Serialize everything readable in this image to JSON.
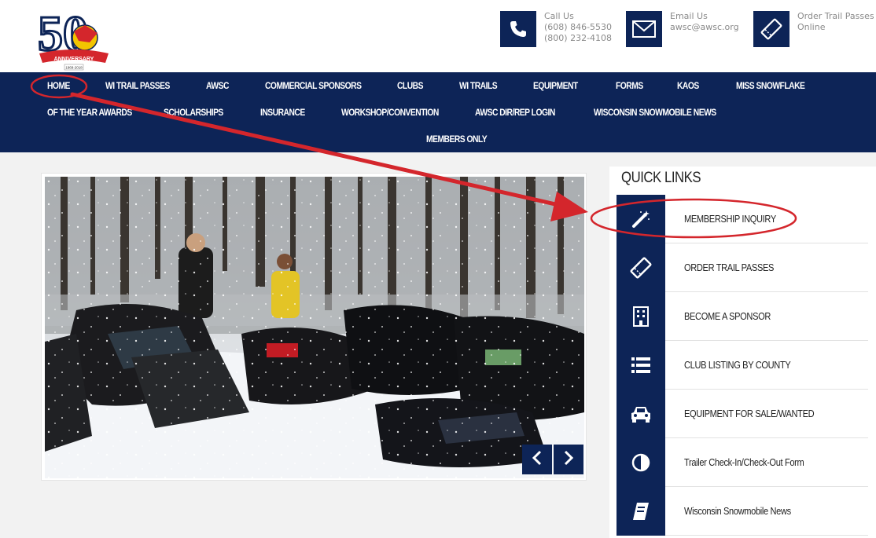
{
  "header": {
    "logo": {
      "number": "50",
      "banner": "ANNIVERSARY",
      "badge": "AWSC",
      "years": "1968-2018"
    },
    "call": {
      "icon": "phone-icon",
      "label": "Call Us",
      "phone1": "(608) 846-5530",
      "phone2": "(800) 232-4108"
    },
    "email": {
      "icon": "envelope-icon",
      "label": "Email Us",
      "address": "awsc@awsc.org"
    },
    "order": {
      "icon": "ticket-icon",
      "label": "Order Trail Passes",
      "label2": "Online"
    }
  },
  "nav": {
    "row1": [
      "HOME",
      "WI TRAIL PASSES",
      "AWSC",
      "COMMERCIAL SPONSORS",
      "CLUBS",
      "WI TRAILS",
      "EQUIPMENT",
      "FORMS",
      "KAOS",
      "MISS SNOWFLAKE"
    ],
    "row2": [
      "OF THE YEAR AWARDS",
      "SCHOLARSHIPS",
      "INSURANCE",
      "WORKSHOP/CONVENTION",
      "AWSC DIR/REP LOGIN",
      "WISCONSIN SNOWMOBILE NEWS"
    ],
    "row3": [
      "MEMBERS ONLY"
    ]
  },
  "slider": {
    "prev_icon": "chevron-left-icon",
    "next_icon": "chevron-right-icon"
  },
  "quick_links": {
    "title": "QUICK LINKS",
    "items": [
      {
        "label": "MEMBERSHIP INQUIRY",
        "icon": "magic-wand-icon"
      },
      {
        "label": "ORDER TRAIL PASSES",
        "icon": "ticket-icon"
      },
      {
        "label": "BECOME A SPONSOR",
        "icon": "building-icon"
      },
      {
        "label": "CLUB LISTING BY COUNTY",
        "icon": "list-icon"
      },
      {
        "label": "EQUIPMENT FOR SALE/WANTED",
        "icon": "car-icon"
      },
      {
        "label": "Trailer Check-In/Check-Out Form",
        "icon": "half-circle-icon"
      },
      {
        "label": "Wisconsin Snowmobile News",
        "icon": "book-icon"
      }
    ]
  },
  "colors": {
    "navy": "#0d2457",
    "annotation_red": "#d4262c",
    "background": "#f2f2f2"
  }
}
